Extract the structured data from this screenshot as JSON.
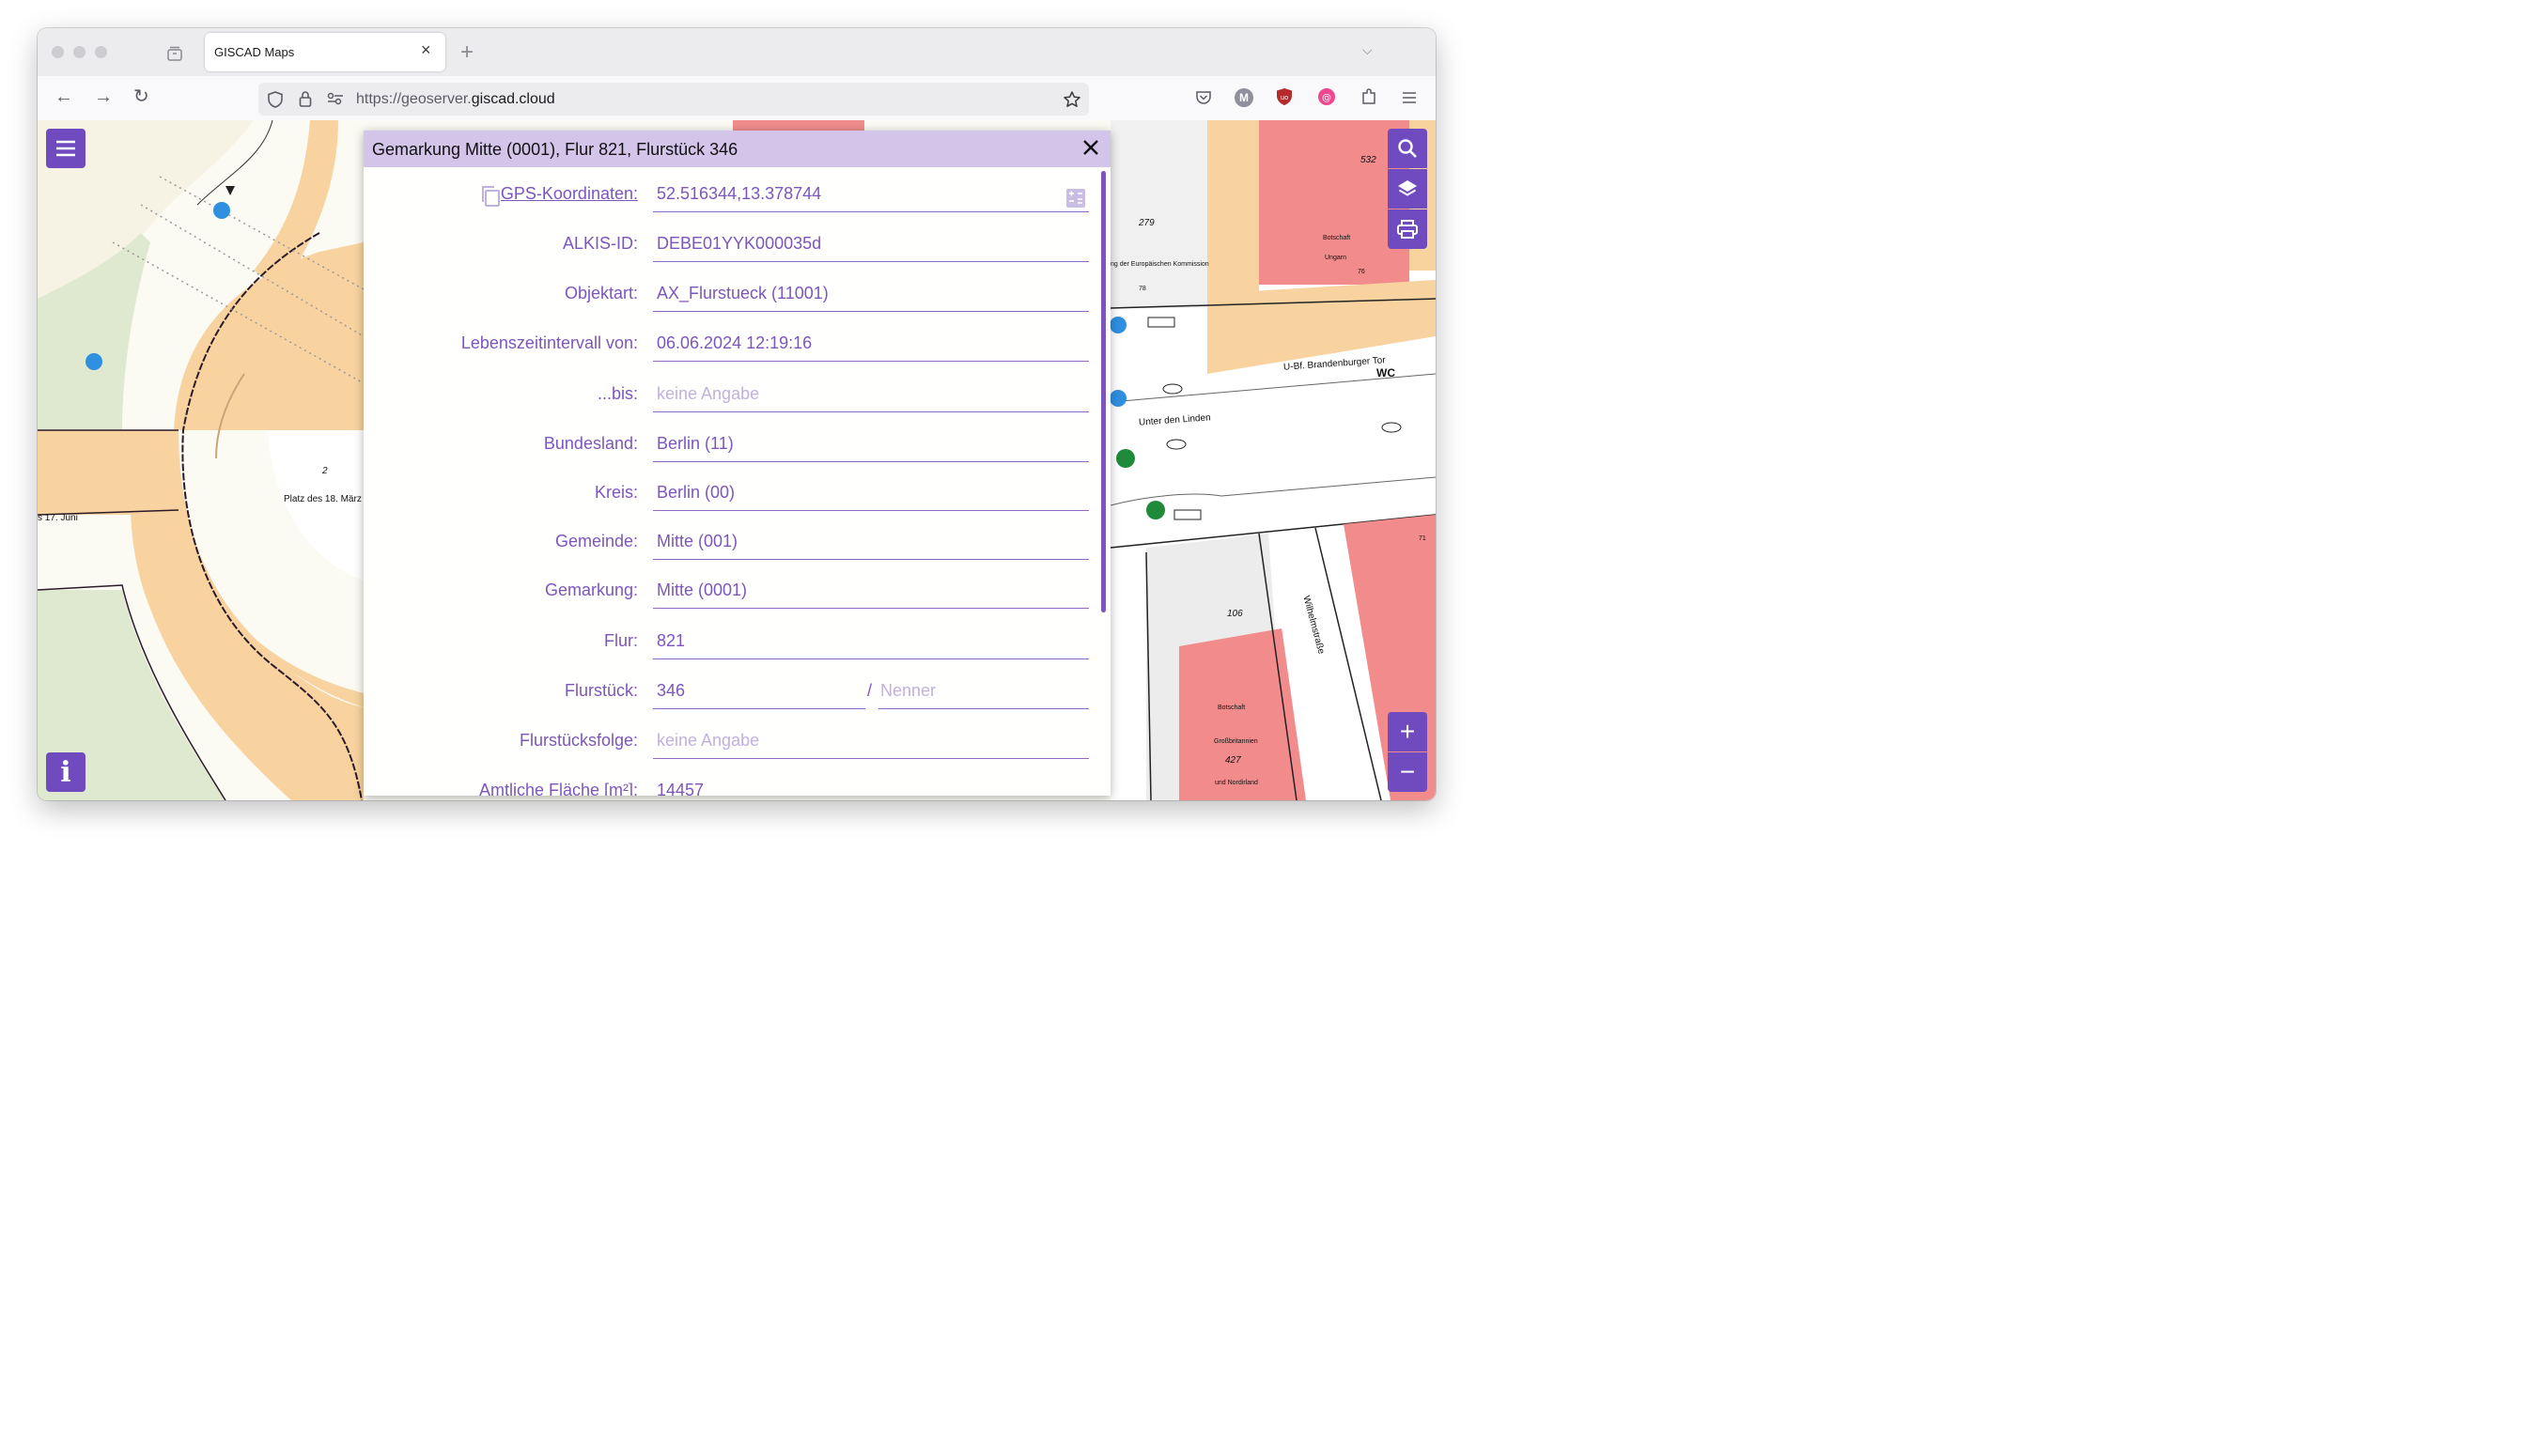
{
  "browser": {
    "tab_title": "GISCAD Maps",
    "url_prefix": "https://geoserver.",
    "url_domain": "giscad.cloud",
    "close_glyph": "×",
    "new_tab_glyph": "+",
    "tab_list_glyph": "⌵",
    "back_glyph": "←",
    "forward_glyph": "→",
    "reload_glyph": "↻",
    "account_initial": "M"
  },
  "map": {
    "labels": {
      "platz": "Platz des 18. März",
      "strasse": "s 17. Juni",
      "platz_num": "2",
      "ubf": "U-Bf. Brandenburger Tor",
      "linden": "Unter den Linden",
      "wc": "WC",
      "botschaft_ungarn": "Botschaft",
      "ungarn": "Ungarn",
      "botschaft_gb": "Botschaft",
      "gb1": "Großbritannien",
      "gb2": "und Nordirland",
      "n427": "427",
      "n106": "106",
      "n279": "279",
      "n532": "532",
      "n78": "78",
      "n76": "76",
      "n71": "71",
      "kommission": "ng der Europäischen Kommission",
      "wilhelm": "Wilhelmstraße"
    },
    "controls": {
      "zoom_in": "+",
      "zoom_out": "−",
      "info": "i"
    }
  },
  "panel": {
    "title": "Gemarkung Mitte (0001), Flur 821, Flurstück 346",
    "fields": [
      {
        "label": "GPS-Koordinaten:",
        "value": "52.516344,13.378744"
      },
      {
        "label": "ALKIS-ID:",
        "value": "DEBE01YYK000035d"
      },
      {
        "label": "Objektart:",
        "value": "AX_Flurstueck (11001)"
      },
      {
        "label": "Lebenszeitintervall von:",
        "value": "06.06.2024 12:19:16"
      },
      {
        "label": "...bis:",
        "value": "keine Angabe"
      },
      {
        "label": "Bundesland:",
        "value": "Berlin (11)"
      },
      {
        "label": "Kreis:",
        "value": "Berlin (00)"
      },
      {
        "label": "Gemeinde:",
        "value": "Mitte (001)"
      },
      {
        "label": "Gemarkung:",
        "value": "Mitte (0001)"
      },
      {
        "label": "Flur:",
        "value": "821"
      },
      {
        "label": "Flurstück:",
        "value": "346",
        "separator": "/",
        "denominator_placeholder": "Nenner"
      },
      {
        "label": "Flurstücksfolge:",
        "value": "keine Angabe"
      },
      {
        "label": "Amtliche Fläche [m²]:",
        "value": "14457"
      }
    ]
  },
  "colors": {
    "accent": "#6f4bbf",
    "label": "#7c55bd",
    "header": "#d3c5ea",
    "road": "#f8d3a0",
    "building_red": "#f28c8c",
    "green": "#dfe9cf"
  }
}
